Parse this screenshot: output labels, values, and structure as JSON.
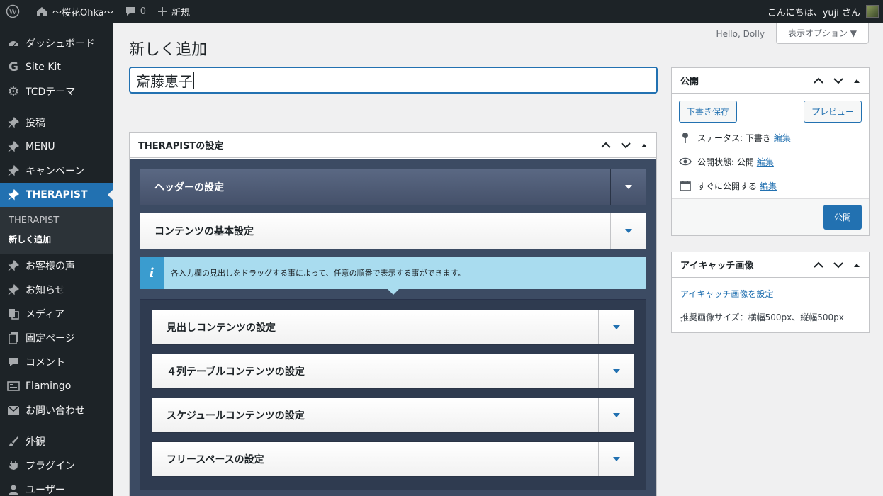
{
  "adminbar": {
    "site_name": "〜桜花Ohka〜",
    "comments_count": "0",
    "new_label": "新規",
    "greeting": "こんにちは、yuji さん"
  },
  "sidebar": {
    "items": [
      {
        "label": "ダッシュボード",
        "icon": "dashboard-icon"
      },
      {
        "label": "Site Kit",
        "icon": "google-icon"
      },
      {
        "label": "TCDテーマ",
        "icon": "gear-icon"
      },
      {
        "label": "投稿",
        "icon": "pin-icon"
      },
      {
        "label": "MENU",
        "icon": "pin-icon"
      },
      {
        "label": "キャンペーン",
        "icon": "pin-icon"
      },
      {
        "label": "THERAPIST",
        "icon": "pin-icon"
      },
      {
        "label": "お客様の声",
        "icon": "pin-icon"
      },
      {
        "label": "お知らせ",
        "icon": "pin-icon"
      },
      {
        "label": "メディア",
        "icon": "media-icon"
      },
      {
        "label": "固定ページ",
        "icon": "page-icon"
      },
      {
        "label": "コメント",
        "icon": "comment-icon"
      },
      {
        "label": "Flamingo",
        "icon": "flamingo-icon"
      },
      {
        "label": "お問い合わせ",
        "icon": "mail-icon"
      },
      {
        "label": "外観",
        "icon": "brush-icon"
      },
      {
        "label": "プラグイン",
        "icon": "plugin-icon"
      },
      {
        "label": "ユーザー",
        "icon": "user-icon"
      }
    ],
    "submenu": {
      "head": "THERAPIST",
      "current": "新しく追加"
    }
  },
  "screen_meta": {
    "dolly": "Hello, Dolly",
    "options_label": "表示オプション ▼"
  },
  "page": {
    "title": "新しく追加",
    "post_title_value": "斎藤恵子"
  },
  "therapist_box": {
    "title": "THERAPISTの設定",
    "sections": [
      {
        "label": "ヘッダーの設定"
      },
      {
        "label": "コンテンツの基本設定"
      }
    ],
    "info_text": "各入力欄の見出しをドラッグする事によって、任意の順番で表示する事ができます。",
    "content_sections": [
      {
        "label": "見出しコンテンツの設定"
      },
      {
        "label": "４列テーブルコンテンツの設定"
      },
      {
        "label": "スケジュールコンテンツの設定"
      },
      {
        "label": "フリースペースの設定"
      }
    ]
  },
  "publish_box": {
    "title": "公開",
    "save_draft": "下書き保存",
    "preview": "プレビュー",
    "status_label": "ステータス: 下書き",
    "visibility_label": "公開状態: 公開",
    "schedule_label": "すぐに公開する",
    "edit_link": "編集",
    "publish_button": "公開"
  },
  "featured_box": {
    "title": "アイキャッチ画像",
    "set_link": "アイキャッチ画像を設定",
    "note": "推奨画像サイズ：横幅500px、縦幅500px"
  },
  "colors": {
    "admin_dark": "#1d2327",
    "accent": "#2271b1",
    "panel": "#3c4b63",
    "info": "#a9dcef"
  }
}
